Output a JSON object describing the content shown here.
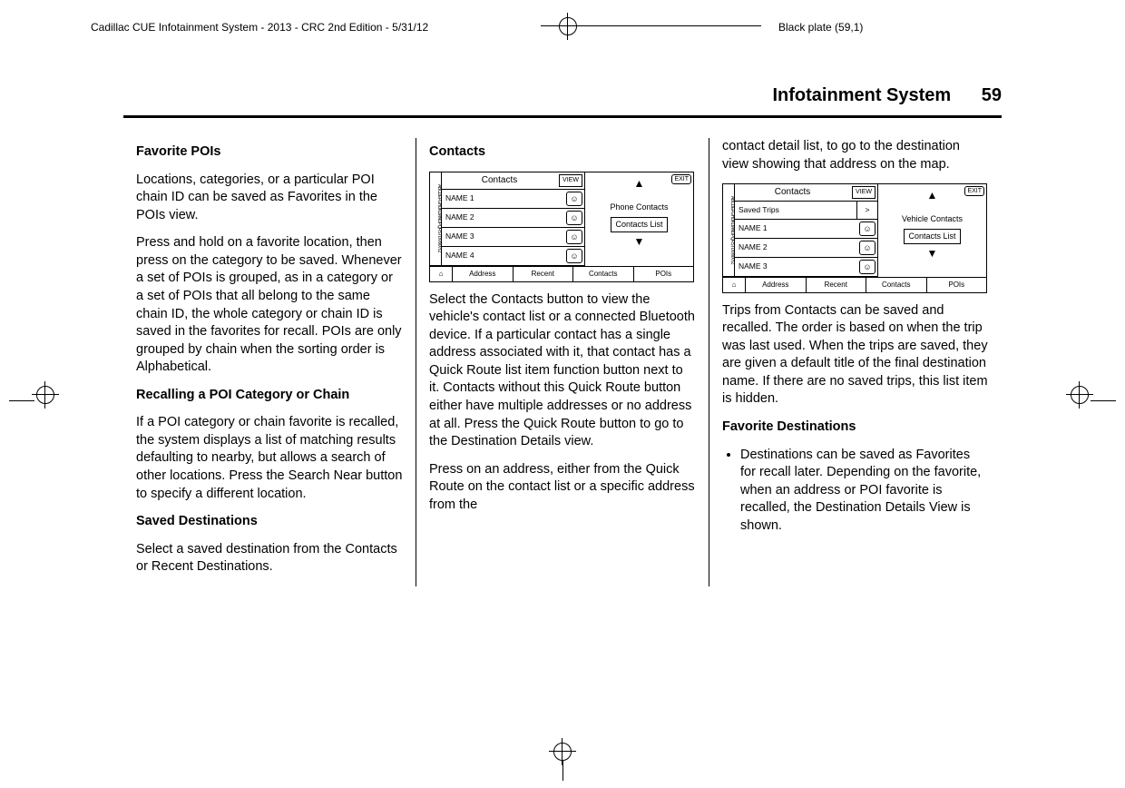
{
  "printHeader": {
    "left": "Cadillac CUE Infotainment System - 2013 - CRC 2nd Edition - 5/31/12",
    "right": "Black plate (59,1)"
  },
  "runningHead": {
    "title": "Infotainment System",
    "page": "59"
  },
  "col1": {
    "h1": "Favorite POIs",
    "p1": "Locations, categories, or a particular POI chain ID can be saved as Favorites in the POIs view.",
    "p2": "Press and hold on a favorite location, then press on the category to be saved. Whenever a set of POIs is grouped, as in a category or a set of POIs that all belong to the same chain ID, the whole category or chain ID is saved in the favorites for recall. POIs are only grouped by chain when the sorting order is Alphabetical.",
    "h2": "Recalling a POI Category or Chain",
    "p3": "If a POI category or chain favorite is recalled, the system displays a list of matching results defaulting to nearby, but allows a search of other locations. Press the Search Near button to specify a different location.",
    "h3": "Saved Destinations",
    "p4": "Select a saved destination from the Contacts or Recent Destinations."
  },
  "col2": {
    "h1": "Contacts",
    "shot": {
      "title": "Contacts",
      "view": "VIEW",
      "exit": "EXIT",
      "rows": [
        "NAME 1",
        "NAME 2",
        "NAME 3",
        "NAME 4"
      ],
      "rightLabel": "Phone Contacts",
      "rightBox": "Contacts List",
      "tabs": [
        "",
        "Address",
        "Recent",
        "Contacts",
        "POIs"
      ],
      "homeIcon": "⌂"
    },
    "p1": "Select the Contacts button to view the vehicle's contact list or a connected Bluetooth device. If a particular contact has a single address associated with it, that contact has a Quick Route list item function button next to it. Contacts without this Quick Route button either have multiple addresses or no address at all. Press the Quick Route button to go to the Destination Details view.",
    "p2": "Press on an address, either from the Quick Route on the contact list or a specific address from the"
  },
  "col3": {
    "p0": "contact detail list, to go to the destination view showing that address on the map.",
    "shot": {
      "title": "Contacts",
      "view": "VIEW",
      "exit": "EXIT",
      "row0": "Saved Trips",
      "row0arrow": ">",
      "rows": [
        "NAME 1",
        "NAME 2",
        "NAME 3"
      ],
      "rightLabel": "Vehicle Contacts",
      "rightBox": "Contacts List",
      "tabs": [
        "",
        "Address",
        "Recent",
        "Contacts",
        "POIs"
      ],
      "homeIcon": "⌂"
    },
    "p1": "Trips from Contacts can be saved and recalled. The order is based on when the trip was last used. When the trips are saved, they are given a default title of the final destination name. If there are no saved trips, this list item is hidden.",
    "h1": "Favorite Destinations",
    "li1": "Destinations can be saved as Favorites for recall later. Depending on the favorite, when an address or POI favorite is recalled, the Destination Details View is shown."
  }
}
